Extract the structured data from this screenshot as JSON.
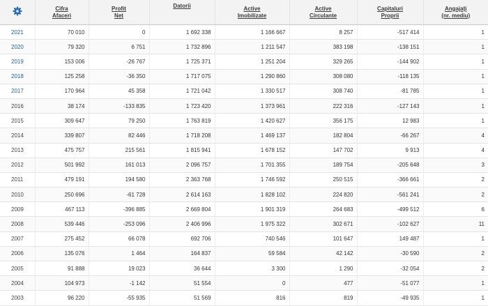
{
  "colors": {
    "header_bg": "#f3f3f3",
    "link": "#1f5f9a",
    "gear": "#2b6cb0"
  },
  "header": {
    "icon": "gear-icon",
    "columns": [
      {
        "l1": "Cifra",
        "l2": "Afaceri"
      },
      {
        "l1": "Profit",
        "l2": "Net"
      },
      {
        "l1": "Datorii",
        "l2": ""
      },
      {
        "l1": "Active",
        "l2": "Imobilizate"
      },
      {
        "l1": "Active",
        "l2": "Circulante"
      },
      {
        "l1": "Capitaluri",
        "l2": "Proprii"
      },
      {
        "l1": "Angajați",
        "l2": "(nr. mediu)"
      }
    ]
  },
  "rows": [
    {
      "year": "2021",
      "link": true,
      "cifra": "70 010",
      "profit": "0",
      "datorii": "1 692 338",
      "imob": "1 166 667",
      "circ": "8 257",
      "cap": "-517 414",
      "ang": "1"
    },
    {
      "year": "2020",
      "link": true,
      "cifra": "79 320",
      "profit": "6 751",
      "datorii": "1 732 896",
      "imob": "1 211 547",
      "circ": "383 198",
      "cap": "-138 151",
      "ang": "1"
    },
    {
      "year": "2019",
      "link": true,
      "cifra": "153 006",
      "profit": "-26 767",
      "datorii": "1 725 371",
      "imob": "1 251 204",
      "circ": "329 265",
      "cap": "-144 902",
      "ang": "1"
    },
    {
      "year": "2018",
      "link": true,
      "cifra": "125 258",
      "profit": "-36 350",
      "datorii": "1 717 075",
      "imob": "1 290 860",
      "circ": "308 080",
      "cap": "-118 135",
      "ang": "1"
    },
    {
      "year": "2017",
      "link": true,
      "cifra": "170 964",
      "profit": "45 358",
      "datorii": "1 721 042",
      "imob": "1 330 517",
      "circ": "308 740",
      "cap": "-81 785",
      "ang": "1"
    },
    {
      "year": "2016",
      "link": false,
      "cifra": "38 174",
      "profit": "-133 835",
      "datorii": "1 723 420",
      "imob": "1 373 961",
      "circ": "222 316",
      "cap": "-127 143",
      "ang": "1"
    },
    {
      "year": "2015",
      "link": false,
      "cifra": "309 647",
      "profit": "79 250",
      "datorii": "1 763 819",
      "imob": "1 420 627",
      "circ": "356 175",
      "cap": "12 983",
      "ang": "1"
    },
    {
      "year": "2014",
      "link": false,
      "cifra": "339 807",
      "profit": "82 446",
      "datorii": "1 718 208",
      "imob": "1 469 137",
      "circ": "182 804",
      "cap": "-66 267",
      "ang": "4"
    },
    {
      "year": "2013",
      "link": false,
      "cifra": "475 757",
      "profit": "215 561",
      "datorii": "1 815 941",
      "imob": "1 678 152",
      "circ": "147 702",
      "cap": "9 913",
      "ang": "4"
    },
    {
      "year": "2012",
      "link": false,
      "cifra": "501 992",
      "profit": "161 013",
      "datorii": "2 096 757",
      "imob": "1 701 355",
      "circ": "189 754",
      "cap": "-205 648",
      "ang": "3"
    },
    {
      "year": "2011",
      "link": false,
      "cifra": "479 191",
      "profit": "194 580",
      "datorii": "2 363 768",
      "imob": "1 746 592",
      "circ": "250 515",
      "cap": "-366 661",
      "ang": "2"
    },
    {
      "year": "2010",
      "link": false,
      "cifra": "250 696",
      "profit": "-61 728",
      "datorii": "2 614 163",
      "imob": "1 828 102",
      "circ": "224 820",
      "cap": "-561 241",
      "ang": "2"
    },
    {
      "year": "2009",
      "link": false,
      "cifra": "467 113",
      "profit": "-396 885",
      "datorii": "2 669 804",
      "imob": "1 901 319",
      "circ": "264 683",
      "cap": "-499 512",
      "ang": "6"
    },
    {
      "year": "2008",
      "link": false,
      "cifra": "539 446",
      "profit": "-253 096",
      "datorii": "2 406 996",
      "imob": "1 975 322",
      "circ": "302 671",
      "cap": "-102 627",
      "ang": "11"
    },
    {
      "year": "2007",
      "link": false,
      "cifra": "275 452",
      "profit": "66 078",
      "datorii": "692 706",
      "imob": "740 546",
      "circ": "101 647",
      "cap": "149 487",
      "ang": "1"
    },
    {
      "year": "2006",
      "link": false,
      "cifra": "135 076",
      "profit": "1 464",
      "datorii": "164 837",
      "imob": "59 584",
      "circ": "42 142",
      "cap": "-30 590",
      "ang": "2"
    },
    {
      "year": "2005",
      "link": false,
      "cifra": "91 888",
      "profit": "19 023",
      "datorii": "36 644",
      "imob": "3 300",
      "circ": "1 290",
      "cap": "-32 054",
      "ang": "2"
    },
    {
      "year": "2004",
      "link": false,
      "cifra": "104 973",
      "profit": "-1 142",
      "datorii": "51 554",
      "imob": "0",
      "circ": "477",
      "cap": "-51 077",
      "ang": "1"
    },
    {
      "year": "2003",
      "link": false,
      "cifra": "96 220",
      "profit": "-55 935",
      "datorii": "51 569",
      "imob": "816",
      "circ": "819",
      "cap": "-49 935",
      "ang": "1"
    }
  ]
}
